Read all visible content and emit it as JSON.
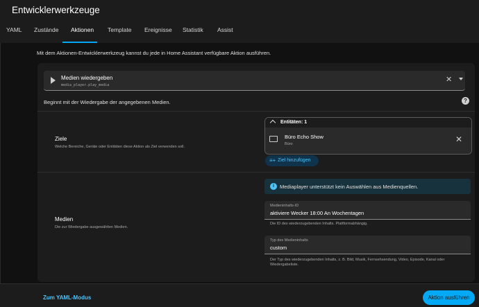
{
  "app": {
    "title": "Entwicklerwerkzeuge"
  },
  "tabs": [
    "YAML",
    "Zustände",
    "Aktionen",
    "Template",
    "Ereignisse",
    "Statistik",
    "Assist"
  ],
  "intro": "Mit dem Aktionen-Entwicklerwerkzeug kannst du jede in Home Assistant verfügbare Aktion ausführen.",
  "action": {
    "name": "Medien wiedergeben",
    "id": "media_player.play_media",
    "description": "Beginnt mit der Wiedergabe der angegebenen Medien."
  },
  "targets": {
    "title": "Ziele",
    "desc": "Welche Bereiche, Geräte oder Entitäten diese Aktion als Ziel verwenden soll.",
    "entities_label": "Entitäten: 1",
    "entity_name": "Büro Echo Show",
    "entity_area": "Büro",
    "add_label": "Ziel hinzufügen"
  },
  "media": {
    "title": "Medien",
    "desc": "Die zur Wiedergabe ausgewählten Medien.",
    "info": "Mediaplayer unterstützt kein Auswählen aus Medienquellen.",
    "content_id_label": "Medieninhalts-ID",
    "content_id_value": "aktiviere Wecker 18:00 An Wochentagen",
    "content_id_helper": "Die ID des wiederzugebenden Inhalts. Plattformabhängig.",
    "content_type_label": "Typ des Medieninhalts",
    "content_type_value": "custom",
    "content_type_helper": "Der Typ des wiederzugebenden Inhalts, z. B. Bild, Musik, Fernsehsendung, Video, Episode, Kanal oder Wiedergabeliste."
  },
  "footer": {
    "yaml_mode": "Zum YAML-Modus",
    "run": "Aktion ausführen"
  },
  "colors": {
    "accent": "#03a9f4",
    "background": "#111111",
    "card": "#1c1c1c"
  }
}
